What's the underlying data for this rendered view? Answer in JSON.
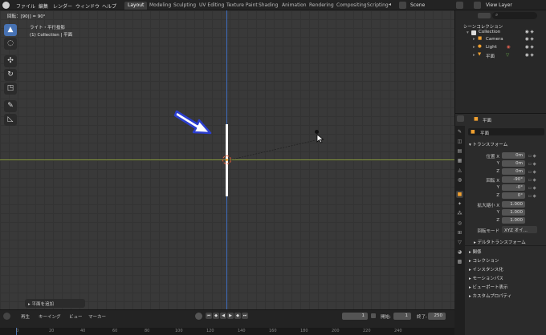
{
  "menubar": {
    "items": [
      "ファイル",
      "編集",
      "レンダー",
      "ウィンドウ",
      "ヘルプ"
    ]
  },
  "workspaces": {
    "tabs": [
      "Layout",
      "Modeling",
      "Sculpting",
      "UV Editing",
      "Texture Paint",
      "Shading",
      "Animation",
      "Rendering",
      "Compositing",
      "Scripting"
    ],
    "active": "Layout",
    "scene": "Scene",
    "view_layer": "View Layer"
  },
  "viewport": {
    "header": "回転：[90|] = 90°",
    "view_name": "ライト・平行投影",
    "collection": "(1) Collection | 平面",
    "add_panel": "平面を追加"
  },
  "outliner": {
    "title": "シーンコレクション",
    "collection": "Collection",
    "items": [
      "Camera",
      "Light",
      "平面"
    ]
  },
  "properties": {
    "object_name": "平面",
    "object_field": "平面",
    "transform_title": "トランスフォーム",
    "location_label": "位置 X",
    "location": [
      "0m",
      "0m",
      "0m"
    ],
    "rotation_label": "回転 X",
    "rotation": [
      "-90°",
      "-0°",
      "0°"
    ],
    "scale_label": "拡大縮小 X",
    "scale": [
      "1.000",
      "1.000",
      "1.000"
    ],
    "axis_y": "Y",
    "axis_z": "Z",
    "rotation_mode_label": "回転モード",
    "rotation_mode": "XYZ オイ...",
    "delta_transform": "デルタトランスフォーム",
    "sections": [
      "関係",
      "コレクション",
      "インスタンス化",
      "モーションパス",
      "ビューポート表示",
      "カスタムプロパティ"
    ]
  },
  "timeline": {
    "menu": [
      "再生",
      "キーイング",
      "ビュー",
      "マーカー"
    ],
    "current_frame": "1",
    "start_label": "開始:",
    "start": "1",
    "end_label": "終了:",
    "end": "250",
    "ruler": [
      "0",
      "20",
      "40",
      "60",
      "80",
      "100",
      "120",
      "140",
      "160",
      "180",
      "200",
      "220",
      "240"
    ]
  },
  "colors": {
    "accent": "#4772b3",
    "object_orange": "#f0a030",
    "axis_x": "#9ab040",
    "axis_z": "#3d6dbf"
  }
}
